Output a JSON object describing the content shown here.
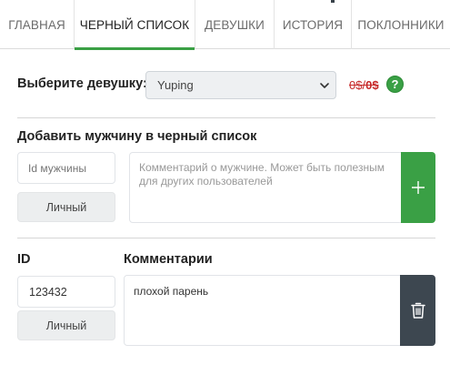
{
  "tabs": [
    {
      "label": "ГЛАВНАЯ",
      "active": false
    },
    {
      "label": "ЧЕРНЫЙ СПИСОК",
      "active": true
    },
    {
      "label": "ДЕВУШКИ",
      "active": false
    },
    {
      "label": "ИСТОРИЯ",
      "active": false
    },
    {
      "label": "ПОКЛОННИКИ",
      "active": false
    }
  ],
  "girl_select": {
    "label": "Выберите девушку:",
    "value": "Yuping",
    "price_old": "0$",
    "price_sep": "/",
    "price_new": "0$",
    "help_symbol": "?"
  },
  "add_form": {
    "title": "Добавить мужчину в черный список",
    "id_placeholder": "Id мужчины",
    "type_button": "Личный",
    "comment_placeholder": "Комментарий о мужчине. Может быть полезным для других пользователей",
    "add_symbol": "+"
  },
  "blacklist": {
    "headers": {
      "id": "ID",
      "comments": "Комментарии"
    },
    "rows": [
      {
        "id": "123432",
        "type": "Личный",
        "comment": "плохой парень"
      }
    ]
  },
  "colors": {
    "accent": "#3aa045",
    "danger": "#c62828",
    "dark_button": "#3d4750"
  }
}
